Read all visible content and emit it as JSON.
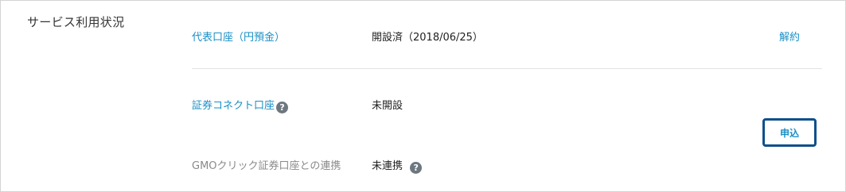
{
  "section": {
    "title": "サービス利用状況"
  },
  "rows": {
    "representative": {
      "label": "代表口座（円預金）",
      "status": "開設済（2018/06/25）",
      "action": "解約"
    },
    "connect": {
      "label": "証券コネクト口座",
      "status": "未開設",
      "help_glyph": "?"
    },
    "gmo": {
      "label": "GMOクリック証券口座との連携",
      "status": "未連携",
      "help_glyph": "?"
    }
  },
  "apply_button": {
    "label": "申込"
  },
  "colors": {
    "link": "#1a8fc5",
    "button_border": "#0e4f8c",
    "help_icon_bg": "#6d7780",
    "muted_label": "#8a8a8a"
  }
}
